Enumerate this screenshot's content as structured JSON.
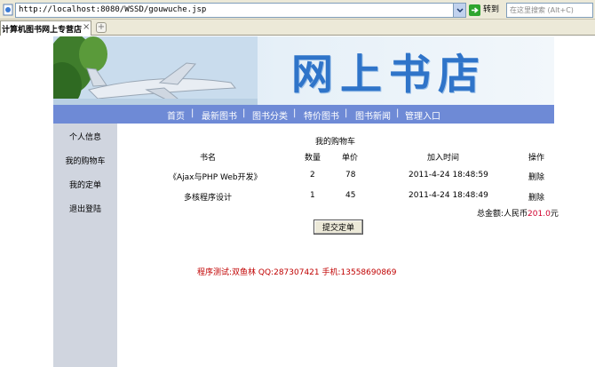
{
  "browser": {
    "url": "http://localhost:8080/WSSD/gouwuche.jsp",
    "go_label": "转到",
    "search_placeholder": "在这里搜索 (Alt+C)",
    "tab_title": "计算机图书网上专营店",
    "tab_close": "×",
    "new_tab": "+"
  },
  "banner": {
    "title": "网上书店"
  },
  "nav": {
    "items": [
      "首页",
      "最新图书",
      "图书分类",
      "特价图书",
      "图书新闻",
      "管理入口"
    ],
    "separator": "|"
  },
  "sidebar": {
    "items": [
      "个人信息",
      "我的购物车",
      "我的定单",
      "退出登陆"
    ]
  },
  "cart": {
    "title": "我的购物车",
    "headers": [
      "书名",
      "数量",
      "单价",
      "加入时间",
      "操作"
    ],
    "rows": [
      {
        "name": "《Ajax与PHP Web开发》",
        "qty": "2",
        "price": "78",
        "time": "2011-4-24 18:48:59",
        "action": "删除"
      },
      {
        "name": "多核程序设计",
        "qty": "1",
        "price": "45",
        "time": "2011-4-24 18:48:49",
        "action": "删除"
      }
    ],
    "total_label": "总金额:人民币",
    "total_amount": "201.0",
    "total_unit": "元",
    "submit_label": "提交定单"
  },
  "footer": {
    "note": "程序测试:双鱼林 QQ:287307421 手机:13558690869"
  },
  "colors": {
    "nav_bg": "#6e8ad6",
    "sidebar_bg": "#d0d5df",
    "banner_title": "#2f74c9",
    "accent_red": "#c00000"
  }
}
